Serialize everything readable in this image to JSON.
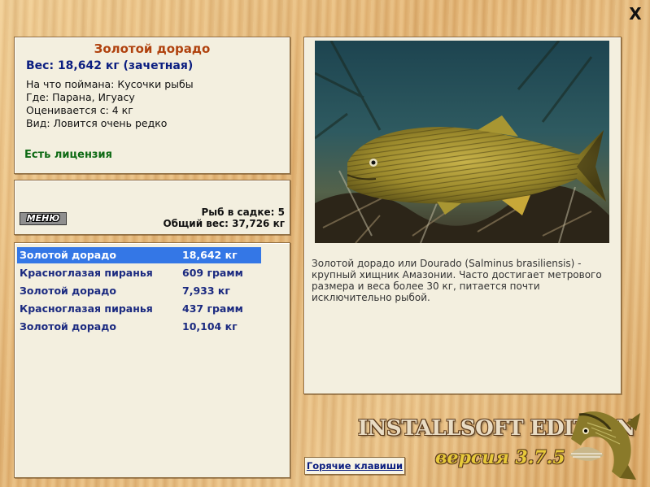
{
  "close_label": "X",
  "fish_info": {
    "title": "Золотой дорадо",
    "weight": "Вес: 18,642 кг (зачетная)",
    "caught_on": "На что поймана: Кусочки рыбы",
    "where": "Где: Парана, Игуасу",
    "rated_from": "Оценивается с: 4 кг",
    "kind": "Вид: Ловится очень редко",
    "license": "Есть лицензия"
  },
  "bag": {
    "menu_label": "МЕНЮ",
    "fish_count": "Рыб в садке: 5",
    "total_weight": "Общий вес: 37,726 кг"
  },
  "catch_list": [
    {
      "name": "Золотой дорадо",
      "weight": "18,642 кг"
    },
    {
      "name": "Красноглазая пиранья",
      "weight": "609 грамм"
    },
    {
      "name": "Золотой дорадо",
      "weight": "7,933 кг"
    },
    {
      "name": "Красноглазая пиранья",
      "weight": "437 грамм"
    },
    {
      "name": "Золотой дорадо",
      "weight": "10,104 кг"
    }
  ],
  "description": "Золотой дорадо или Dourado (Salminus brasiliensis) - крупный хищник Амазонии. Часто достигает метрового размера и веса более 30 кг, питается почти исключительно рыбой.",
  "brand": {
    "edition": "INSTALLSOFT EDITION",
    "version": "версия 3.7.5"
  },
  "hotkeys_label": "Горячие клавиши",
  "colors": {
    "selection": "#3477e6",
    "title": "#b0420e",
    "license": "#0e6a14",
    "list_text": "#1b2a80"
  }
}
